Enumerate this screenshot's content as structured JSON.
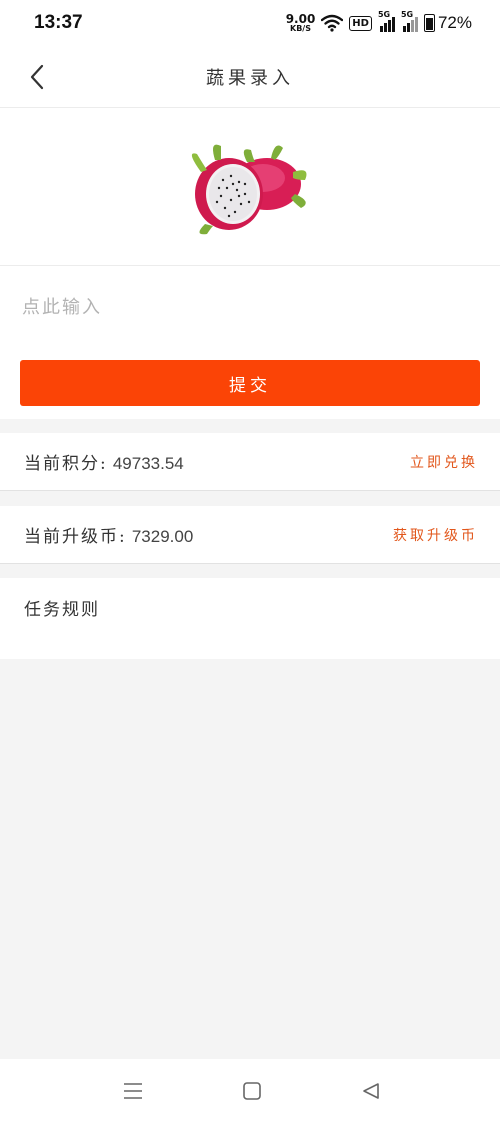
{
  "status_bar": {
    "time": "13:37",
    "net_speed_value": "9.00",
    "net_speed_unit": "KB/S",
    "hd_label": "HD",
    "signal_1_label": "5G",
    "signal_2_label": "5G",
    "battery_percent": "72%",
    "battery_level": 0.72,
    "icons": [
      "wifi-icon",
      "signal-icon",
      "battery-icon"
    ]
  },
  "header": {
    "title": "蔬果录入",
    "back_icon": "chevron-left-icon"
  },
  "product": {
    "image_icon": "dragon-fruit-image"
  },
  "form": {
    "input_value": "",
    "input_placeholder": "点此输入",
    "submit_label": "提交"
  },
  "points_row": {
    "label": "当前积分:",
    "value": "49733.54",
    "action_label": "立即兑换"
  },
  "coins_row": {
    "label": "当前升级币:",
    "value": "7329.00",
    "action_label": "获取升级币"
  },
  "rules": {
    "title": "任务规则"
  },
  "system_nav": {
    "icons": [
      "menu-icon",
      "home-icon",
      "back-triangle-icon"
    ]
  },
  "colors": {
    "accent": "#fb4406",
    "link": "#e2571c",
    "background": "#f4f4f4"
  }
}
